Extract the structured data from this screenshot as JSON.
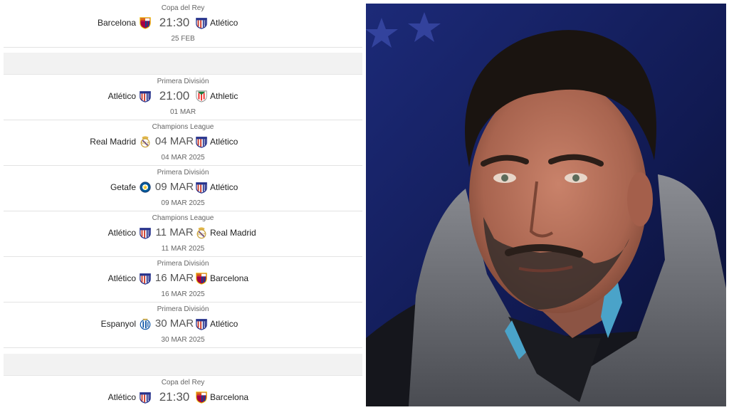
{
  "fixtures": [
    {
      "competition": "Copa del Rey",
      "home": "Barcelona",
      "home_crest": "barcelona-crest-icon",
      "center": "21:30",
      "away": "Atlético",
      "away_crest": "atletico-crest-icon",
      "sub": "25 FEB"
    },
    {
      "competition": "Primera División",
      "home": "Atlético",
      "home_crest": "atletico-crest-icon",
      "center": "21:00",
      "away": "Athletic",
      "away_crest": "athletic-crest-icon",
      "sub": "01 MAR"
    },
    {
      "competition": "Champions League",
      "home": "Real Madrid",
      "home_crest": "real-madrid-crest-icon",
      "center": "04 MAR",
      "away": "Atlético",
      "away_crest": "atletico-crest-icon",
      "sub": "04 MAR 2025"
    },
    {
      "competition": "Primera División",
      "home": "Getafe",
      "home_crest": "getafe-crest-icon",
      "center": "09 MAR",
      "away": "Atlético",
      "away_crest": "atletico-crest-icon",
      "sub": "09 MAR 2025"
    },
    {
      "competition": "Champions League",
      "home": "Atlético",
      "home_crest": "atletico-crest-icon",
      "center": "11 MAR",
      "away": "Real Madrid",
      "away_crest": "real-madrid-crest-icon",
      "sub": "11 MAR 2025"
    },
    {
      "competition": "Primera División",
      "home": "Atlético",
      "home_crest": "atletico-crest-icon",
      "center": "16 MAR",
      "away": "Barcelona",
      "away_crest": "barcelona-crest-icon",
      "sub": "16 MAR 2025"
    },
    {
      "competition": "Primera División",
      "home": "Espanyol",
      "home_crest": "espanyol-crest-icon",
      "center": "30 MAR",
      "away": "Atlético",
      "away_crest": "atletico-crest-icon",
      "sub": "30 MAR 2025"
    },
    {
      "competition": "Copa del Rey",
      "home": "Atlético",
      "home_crest": "atletico-crest-icon",
      "center": "21:30",
      "away": "Barcelona",
      "away_crest": "barcelona-crest-icon",
      "sub": ""
    }
  ],
  "photo": {
    "subject": "coach-portrait-photo"
  }
}
